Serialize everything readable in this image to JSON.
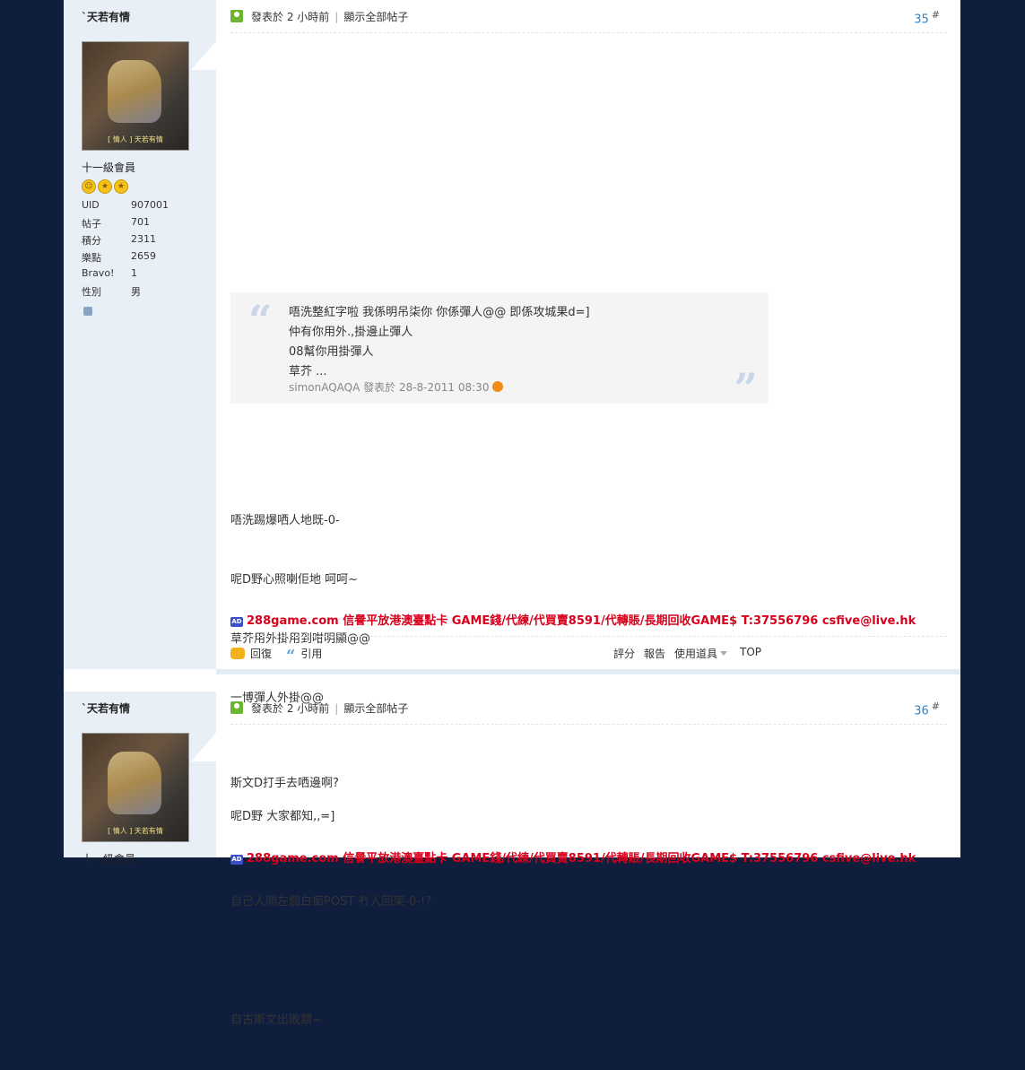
{
  "posts": [
    {
      "author": "`天若有情",
      "avatar_caption": "[ 情人 ] 天若有情",
      "rank": "十一級會員",
      "stats": [
        {
          "k": "UID",
          "v": "907001"
        },
        {
          "k": "帖子",
          "v": "701"
        },
        {
          "k": "積分",
          "v": "2311"
        },
        {
          "k": "樂點",
          "v": "2659"
        },
        {
          "k": "Bravo!",
          "v": "1"
        },
        {
          "k": "性別",
          "v": "男"
        }
      ],
      "posted": "發表於 2 小時前",
      "show_all": "顯示全部帖子",
      "floor": "35",
      "floor_mark": "#",
      "quote": {
        "lines": [
          "唔洗整紅字啦 我係明吊柒你 你係彈人@@ 即係攻城果d=]",
          "仲有你用外.,掛邊止彈人",
          "08幫你用掛彈人",
          "草芥 ..."
        ],
        "by": "simonAQAQA 發表於 28-8-2011 08:30"
      },
      "body": [
        "唔洗踢爆哂人地既-0-",
        "呢D野心照喇佢地 呵呵~",
        "草芥用外掛用到咁明顯@@",
        "一博彈人外掛@@",
        "",
        "呢D野 大家都知,,=]"
      ],
      "ad": "288game.com 信譽平放港澳臺點卡 GAME錢/代練/代買賣8591/代轉賬/長期回收GAME$ T:37556796 csfive@live.hk",
      "actions": {
        "reply": "回復",
        "quote": "引用",
        "rate": "評分",
        "report": "報告",
        "tools": "使用道具",
        "top": "TOP"
      }
    },
    {
      "author": "`天若有情",
      "avatar_caption": "[ 情人 ] 天若有情",
      "rank": "十一級會員",
      "posted": "發表於 2 小時前",
      "show_all": "顯示全部帖子",
      "floor": "36",
      "floor_mark": "#",
      "body": [
        "斯文D打手去哂邊啊?",
        "",
        "自己人開左個白痴POST 冇人回架-0-!?",
        "",
        "自古斯文出敗類~"
      ],
      "ad": "288game.com 信譽平放港澳臺點卡 GAME錢/代練/代買賣8591/代轉賬/長期回收GAME$ T:37556796 csfive@live.hk"
    }
  ],
  "star_icons": [
    "smile-icon",
    "star-icon",
    "star-icon"
  ],
  "colors": {
    "background": "#0f1e3d",
    "sidebar": "#e8eff7",
    "floor_link": "#2b86c8",
    "ad_red": "#d8001c"
  }
}
